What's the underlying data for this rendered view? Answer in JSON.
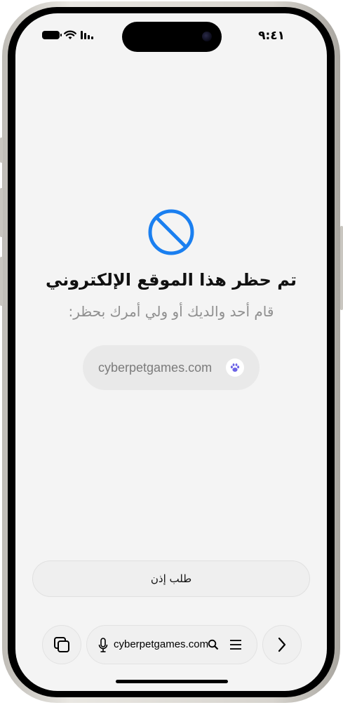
{
  "status_bar": {
    "time": "٩:٤١"
  },
  "blocked_page": {
    "title": "تم حظر هذا الموقع الإلكتروني",
    "subtitle": "قام أحد والديك أو ولي أمرك بحظر:",
    "site": "cyberpetgames.com",
    "site_icon": "paw-icon",
    "request_button_label": "طلب إذن"
  },
  "toolbar": {
    "address": "cyberpetgames.com",
    "icons": [
      "tabs-icon",
      "microphone-icon",
      "search-icon",
      "menu-icon",
      "forward-icon"
    ]
  },
  "colors": {
    "accent": "#1a7ff0",
    "paw": "#6c63e6",
    "background": "#f4f4f4"
  }
}
